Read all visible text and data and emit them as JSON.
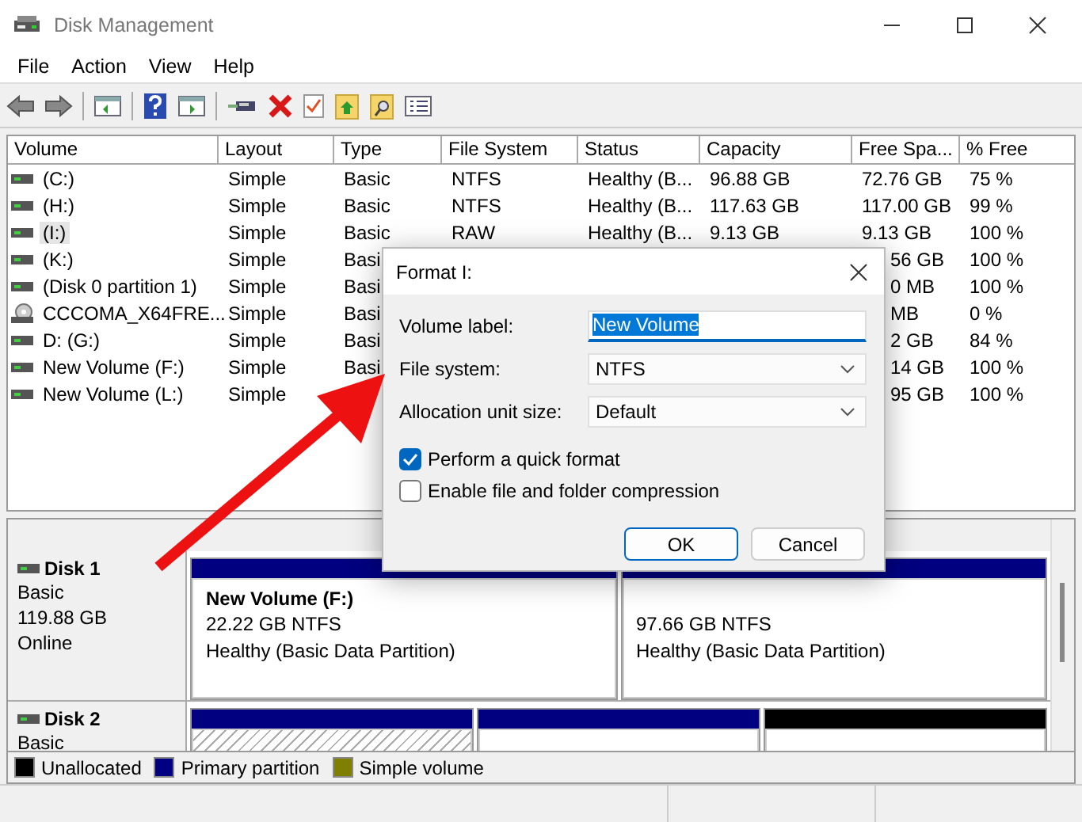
{
  "window": {
    "title": "Disk Management"
  },
  "menu": [
    "File",
    "Action",
    "View",
    "Help"
  ],
  "table": {
    "columns": [
      "Volume",
      "Layout",
      "Type",
      "File System",
      "Status",
      "Capacity",
      "Free Spa...",
      "% Free"
    ],
    "rows": [
      {
        "kind": "disk",
        "selected": false,
        "volume": "(C:)",
        "layout": "Simple",
        "type": "Basic",
        "file_system": "NTFS",
        "status": "Healthy (B...",
        "capacity": "96.88 GB",
        "free_space": "72.76 GB",
        "percent_free": "75 %"
      },
      {
        "kind": "disk",
        "selected": false,
        "volume": "(H:)",
        "layout": "Simple",
        "type": "Basic",
        "file_system": "NTFS",
        "status": "Healthy (B...",
        "capacity": "117.63 GB",
        "free_space": "117.00 GB",
        "percent_free": "99 %"
      },
      {
        "kind": "disk",
        "selected": true,
        "volume": "(I:)",
        "layout": "Simple",
        "type": "Basic",
        "file_system": "RAW",
        "status": "Healthy (B...",
        "capacity": "9.13 GB",
        "free_space": "9.13 GB",
        "percent_free": "100 %"
      },
      {
        "kind": "disk",
        "selected": false,
        "volume": "(K:)",
        "layout": "Simple",
        "type": "Basi",
        "free_space": "56 GB",
        "percent_free": "100 %"
      },
      {
        "kind": "disk",
        "selected": false,
        "volume": "(Disk 0 partition 1)",
        "layout": "Simple",
        "type": "Basi",
        "free_space": "0 MB",
        "percent_free": "100 %"
      },
      {
        "kind": "disc",
        "selected": false,
        "volume": "CCCOMA_X64FRE...",
        "layout": "Simple",
        "type": "Basi",
        "free_space": "MB",
        "percent_free": "0 %"
      },
      {
        "kind": "disk",
        "selected": false,
        "volume": "D: (G:)",
        "layout": "Simple",
        "type": "Basi",
        "free_space": "2 GB",
        "percent_free": "84 %"
      },
      {
        "kind": "disk",
        "selected": false,
        "volume": "New Volume (F:)",
        "layout": "Simple",
        "type": "Basi",
        "free_space": "14 GB",
        "percent_free": "100 %"
      },
      {
        "kind": "disk",
        "selected": false,
        "volume": "New Volume (L:)",
        "layout": "Simple",
        "free_space": "95 GB",
        "percent_free": "100 %"
      }
    ]
  },
  "disks": [
    {
      "name": "Disk 1",
      "lines": [
        "Basic",
        "119.88 GB",
        "Online"
      ],
      "partitions": [
        {
          "kind": "primary",
          "selected": false,
          "name": "New Volume  (F:)",
          "size": "22.22 GB NTFS",
          "status": "Healthy (Basic Data Partition)"
        },
        {
          "kind": "primary",
          "selected": false,
          "size": "97.66 GB NTFS",
          "status": "Healthy (Basic Data Partition)"
        }
      ]
    },
    {
      "name": "Disk 2",
      "lines": [
        "Basic"
      ],
      "partitions": [
        {
          "kind": "primary",
          "selected": true
        },
        {
          "kind": "primary",
          "selected": false
        },
        {
          "kind": "unallocated",
          "selected": false
        }
      ]
    }
  ],
  "legend": [
    {
      "label": "Unallocated",
      "color": "#000000"
    },
    {
      "label": "Primary partition",
      "color": "#000080"
    },
    {
      "label": "Simple volume",
      "color": "#808000"
    }
  ],
  "dialog": {
    "title": "Format I:",
    "fields": [
      {
        "kind": "text",
        "label": "Volume label:",
        "value": "New Volume"
      },
      {
        "kind": "select",
        "label": "File system:",
        "value": "NTFS"
      },
      {
        "kind": "select",
        "label": "Allocation unit size:",
        "value": "Default"
      }
    ],
    "options": [
      {
        "label": "Perform a quick format",
        "checked": true
      },
      {
        "label": "Enable file and folder compression",
        "checked": false
      }
    ],
    "buttons": [
      {
        "label": "OK",
        "default": true
      },
      {
        "label": "Cancel",
        "default": false
      }
    ]
  }
}
